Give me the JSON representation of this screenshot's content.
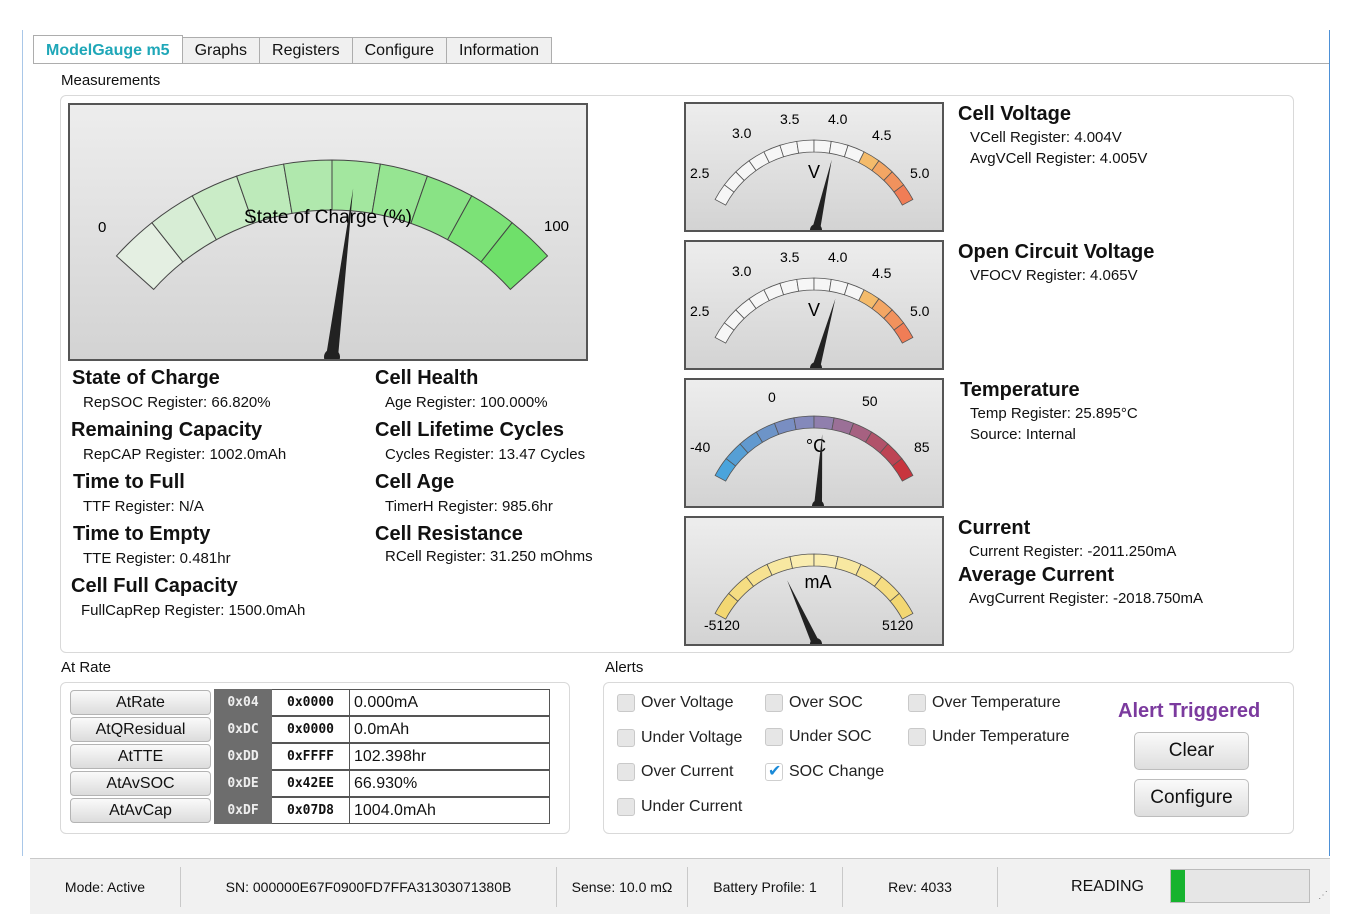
{
  "tabs": [
    "ModelGauge m5",
    "Graphs",
    "Registers",
    "Configure",
    "Information"
  ],
  "sections": {
    "measurements": "Measurements",
    "at_rate": "At Rate",
    "alerts": "Alerts"
  },
  "soc_gauge": {
    "label": "State of Charge (%)",
    "min": "0",
    "max": "100",
    "value": 66.82
  },
  "measurements": {
    "soc": {
      "title": "State of Charge",
      "detail": "RepSOC Register: 66.820%"
    },
    "remaining": {
      "title": "Remaining Capacity",
      "detail": "RepCAP Register: 1002.0mAh"
    },
    "ttf": {
      "title": "Time to Full",
      "detail": "TTF Register: N/A"
    },
    "tte": {
      "title": "Time to Empty",
      "detail": "TTE Register: 0.481hr"
    },
    "fullcap": {
      "title": "Cell Full Capacity",
      "detail": "FullCapRep Register: 1500.0mAh"
    },
    "health": {
      "title": "Cell Health",
      "detail": "Age Register: 100.000%"
    },
    "cycles": {
      "title": "Cell Lifetime Cycles",
      "detail": "Cycles Register: 13.47 Cycles"
    },
    "age": {
      "title": "Cell Age",
      "detail": "TimerH Register: 985.6hr"
    },
    "resistance": {
      "title": "Cell Resistance",
      "detail": "RCell Register: 31.250 mOhms"
    }
  },
  "gauges": {
    "vcell": {
      "unit": "V",
      "ticks": [
        "2.5",
        "3.0",
        "3.5",
        "4.0",
        "4.5",
        "5.0"
      ],
      "value": 4.004
    },
    "ocv": {
      "unit": "V",
      "ticks": [
        "2.5",
        "3.0",
        "3.5",
        "4.0",
        "4.5",
        "5.0"
      ],
      "value": 4.065
    },
    "temp": {
      "unit": "°C",
      "ticks": [
        "-40",
        "0",
        "50",
        "85"
      ],
      "value": 25.895
    },
    "current": {
      "unit": "mA",
      "ticks": [
        "-5120",
        "5120"
      ],
      "value": -2011.25
    }
  },
  "right": {
    "cell_voltage": {
      "title": "Cell Voltage",
      "l1": "VCell Register: 4.004V",
      "l2": "AvgVCell Register: 4.005V"
    },
    "ocv": {
      "title": "Open Circuit Voltage",
      "l1": "VFOCV Register: 4.065V"
    },
    "temperature": {
      "title": "Temperature",
      "l1": "Temp Register: 25.895°C",
      "l2": "Source: Internal"
    },
    "current": {
      "title": "Current",
      "l1": "Current Register: -2011.250mA"
    },
    "avg_current": {
      "title": "Average Current",
      "l1": "AvgCurrent Register: -2018.750mA"
    }
  },
  "at_rate": [
    {
      "label": "AtRate",
      "addr": "0x04",
      "hex": "0x0000",
      "value": "0.000mA"
    },
    {
      "label": "AtQResidual",
      "addr": "0xDC",
      "hex": "0x0000",
      "value": "0.0mAh"
    },
    {
      "label": "AtTTE",
      "addr": "0xDD",
      "hex": "0xFFFF",
      "value": "102.398hr"
    },
    {
      "label": "AtAvSOC",
      "addr": "0xDE",
      "hex": "0x42EE",
      "value": "66.930%"
    },
    {
      "label": "AtAvCap",
      "addr": "0xDF",
      "hex": "0x07D8",
      "value": "1004.0mAh"
    }
  ],
  "alerts": {
    "over_voltage": "Over Voltage",
    "under_voltage": "Under Voltage",
    "over_current": "Over Current",
    "under_current": "Under Current",
    "over_soc": "Over SOC",
    "under_soc": "Under SOC",
    "soc_change": "SOC Change",
    "over_temp": "Over Temperature",
    "under_temp": "Under Temperature",
    "soc_change_checked": true,
    "triggered": "Alert Triggered",
    "clear": "Clear",
    "configure": "Configure"
  },
  "status": {
    "mode": "Mode: Active",
    "sn": "SN: 000000E67F0900FD7FFA31303071380B",
    "sense": "Sense: 10.0 mΩ",
    "profile": "Battery Profile: 1",
    "rev": "Rev: 4033",
    "reading": "READING",
    "progress": 0.1
  }
}
